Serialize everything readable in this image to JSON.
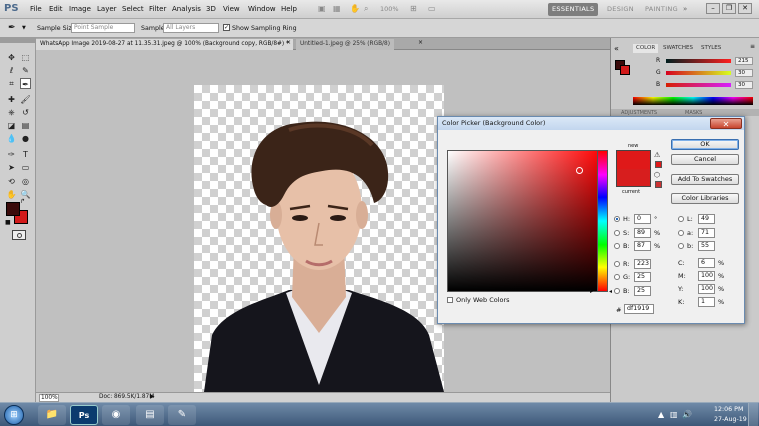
{
  "app": {
    "logo": "PS"
  },
  "menu": [
    "File",
    "Edit",
    "Image",
    "Layer",
    "Select",
    "Filter",
    "Analysis",
    "3D",
    "View",
    "Window",
    "Help"
  ],
  "zoom_display": "100%",
  "workspaces": [
    "ESSENTIALS",
    "DESIGN",
    "PAINTING"
  ],
  "options": {
    "sample_size_label": "Sample Size:",
    "sample_size_value": "Point Sample",
    "sample_label": "Sample:",
    "sample_value": "All Layers",
    "show_ring_label": "Show Sampling Ring",
    "show_ring_checked": true
  },
  "tabs": [
    {
      "label": "WhatsApp Image 2019-08-27 at 11.35.31.jpeg @ 100% (Background copy, RGB/8#) *",
      "active": true
    },
    {
      "label": "Untitled-1.jpeg @ 25% (RGB/8)",
      "active": false
    }
  ],
  "status": {
    "zoom": "100%",
    "doc": "Doc: 869.5K/1.87M"
  },
  "color_panel": {
    "tabs": [
      "COLOR",
      "SWATCHES",
      "STYLES"
    ],
    "channels": [
      {
        "label": "R",
        "value": "215"
      },
      {
        "label": "G",
        "value": "30"
      },
      {
        "label": "B",
        "value": "30"
      }
    ],
    "lower_tabs": [
      "ADJUSTMENTS",
      "MASKS"
    ]
  },
  "dialog": {
    "title": "Color Picker (Background Color)",
    "new_label": "new",
    "current_label": "current",
    "buttons": {
      "ok": "OK",
      "cancel": "Cancel",
      "swatches": "Add To Swatches",
      "libraries": "Color Libraries"
    },
    "only_web": "Only Web Colors",
    "fields_left": [
      {
        "label": "H:",
        "value": "0",
        "unit": "°",
        "selected": true
      },
      {
        "label": "S:",
        "value": "89",
        "unit": "%",
        "selected": false
      },
      {
        "label": "B:",
        "value": "87",
        "unit": "%",
        "selected": false
      },
      {
        "label": "R:",
        "value": "223",
        "unit": "",
        "selected": false
      },
      {
        "label": "G:",
        "value": "25",
        "unit": "",
        "selected": false
      },
      {
        "label": "B:",
        "value": "25",
        "unit": "",
        "selected": false
      }
    ],
    "fields_lab": [
      {
        "label": "L:",
        "value": "49"
      },
      {
        "label": "a:",
        "value": "71"
      },
      {
        "label": "b:",
        "value": "55"
      }
    ],
    "fields_cmyk": [
      {
        "label": "C:",
        "value": "6",
        "unit": "%"
      },
      {
        "label": "M:",
        "value": "100",
        "unit": "%"
      },
      {
        "label": "Y:",
        "value": "100",
        "unit": "%"
      },
      {
        "label": "K:",
        "value": "1",
        "unit": "%"
      }
    ],
    "hex_label": "#",
    "hex_value": "df1919"
  },
  "colors": {
    "new": "#df1919",
    "current": "#d71e1e",
    "foreground": "#3a0a0a",
    "background": "#d21a1a"
  },
  "taskbar": {
    "time": "12:06 PM",
    "date": "27-Aug-19"
  }
}
